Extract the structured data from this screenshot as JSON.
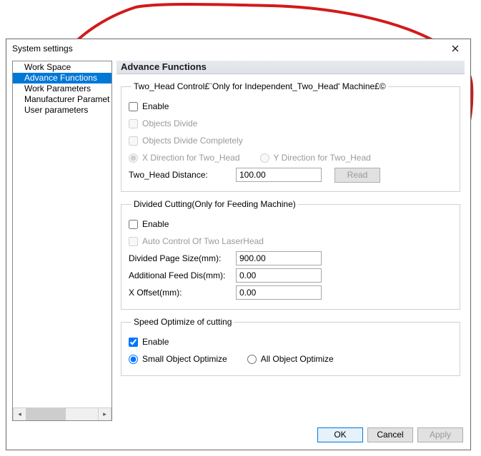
{
  "window": {
    "title": "System settings"
  },
  "sidebar": {
    "items": [
      {
        "label": "Work Space"
      },
      {
        "label": "Advance Functions"
      },
      {
        "label": "Work Parameters"
      },
      {
        "label": "Manufacturer Paramet"
      },
      {
        "label": "User parameters"
      }
    ],
    "selected_index": 1
  },
  "header": {
    "title": "Advance Functions"
  },
  "group_two_head": {
    "legend": "Two_Head Control£¨Only for Independent_Two_Head' Machine£©",
    "enable": "Enable",
    "objects_divide": "Objects Divide",
    "objects_divide_completely": "Objects Divide Completely",
    "x_dir": "X Direction for Two_Head",
    "y_dir": "Y Direction for Two_Head",
    "distance_label": "Two_Head Distance:",
    "distance_value": "100.00",
    "read": "Read"
  },
  "group_divided": {
    "legend": "Divided Cutting(Only for Feeding Machine)",
    "enable": "Enable",
    "auto_control": "Auto Control Of Two LaserHead",
    "page_size_label": "Divided Page Size(mm):",
    "page_size_value": "900.00",
    "feed_label": "Additional Feed Dis(mm):",
    "feed_value": "0.00",
    "xoffset_label": "X Offset(mm):",
    "xoffset_value": "0.00"
  },
  "group_speed": {
    "legend": "Speed Optimize of cutting",
    "enable": "Enable",
    "small": "Small Object Optimize",
    "all": "All Object Optimize"
  },
  "footer": {
    "ok": "OK",
    "cancel": "Cancel",
    "apply": "Apply"
  }
}
